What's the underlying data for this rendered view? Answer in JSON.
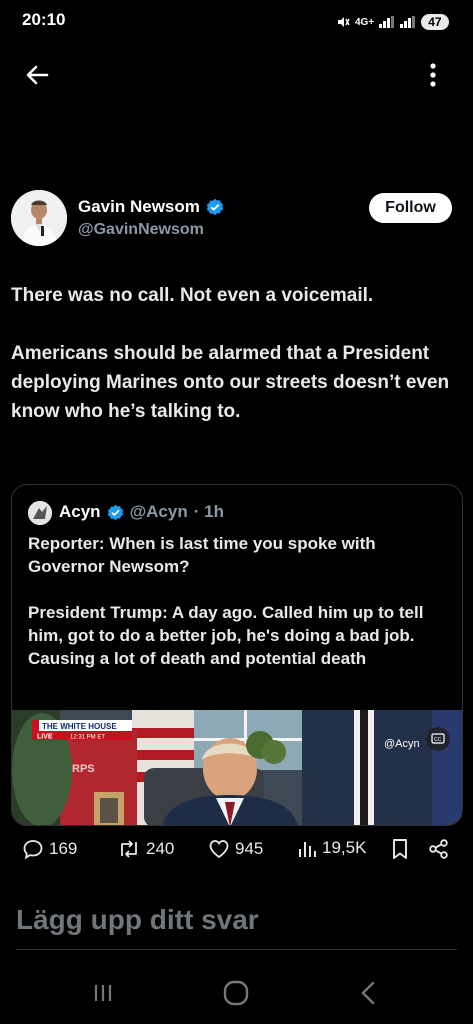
{
  "status": {
    "time": "20:10",
    "network": "4G+",
    "battery": "47"
  },
  "tweet": {
    "author_name": "Gavin Newsom",
    "author_handle": "@GavinNewsom",
    "follow_label": "Follow",
    "paragraphs": [
      "There was no call. Not even a voicemail.",
      "Americans should be alarmed that a President deploying Marines onto our streets doesn’t even know who he’s talking to."
    ]
  },
  "quote": {
    "name": "Acyn",
    "handle": "@Acyn",
    "time": "· 1h",
    "paragraphs": [
      "Reporter: When is last time you spoke with Governor Newsom?",
      "President Trump: A day ago. Called him up to tell him, got to do a better job, he's doing a bad job. Causing a lot of death and potential death"
    ],
    "video": {
      "banner_title": "THE WHITE HOUSE",
      "banner_live": "LIVE",
      "banner_time": "12:31 PM ET",
      "watermark": "@Acyn",
      "sign_text": "RPS"
    }
  },
  "actions": {
    "replies": "169",
    "reposts": "240",
    "likes": "945",
    "views": "19,5K"
  },
  "reply": {
    "placeholder": "Lägg upp ditt svar"
  },
  "colors": {
    "verified": "#1d9bf0",
    "background": "#000000",
    "secondary_text": "#8b98a5"
  }
}
